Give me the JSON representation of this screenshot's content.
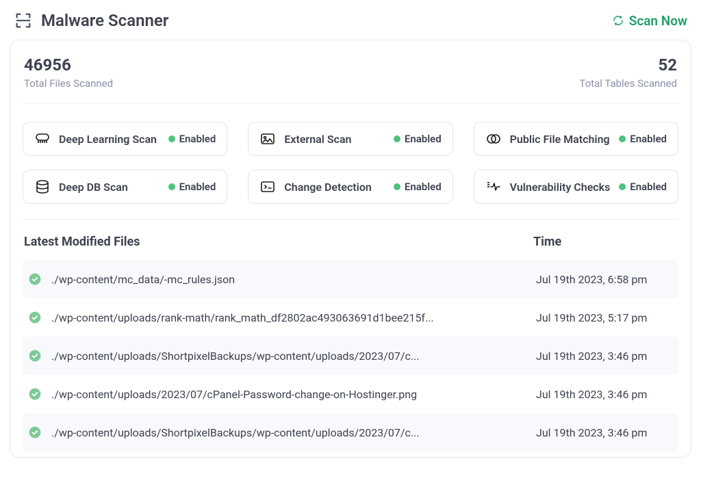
{
  "header": {
    "title": "Malware Scanner",
    "scan_now_label": "Scan Now"
  },
  "stats": {
    "files_scanned_value": "46956",
    "files_scanned_label": "Total Files Scanned",
    "tables_scanned_value": "52",
    "tables_scanned_label": "Total Tables Scanned"
  },
  "features": [
    {
      "name": "Deep Learning Scan",
      "status": "Enabled",
      "iconKey": "deep-learning"
    },
    {
      "name": "External Scan",
      "status": "Enabled",
      "iconKey": "external"
    },
    {
      "name": "Public File Matching",
      "status": "Enabled",
      "iconKey": "public-file"
    },
    {
      "name": "Deep DB Scan",
      "status": "Enabled",
      "iconKey": "db"
    },
    {
      "name": "Change Detection",
      "status": "Enabled",
      "iconKey": "change"
    },
    {
      "name": "Vulnerability Checks",
      "status": "Enabled",
      "iconKey": "vuln"
    }
  ],
  "files_table": {
    "header_file": "Latest Modified Files",
    "header_time": "Time",
    "rows": [
      {
        "path": "./wp-content/mc_data/-mc_rules.json",
        "time": "Jul 19th 2023, 6:58 pm"
      },
      {
        "path": "./wp-content/uploads/rank-math/rank_math_df2802ac493063691d1bee215f...",
        "time": "Jul 19th 2023, 5:17 pm"
      },
      {
        "path": "./wp-content/uploads/ShortpixelBackups/wp-content/uploads/2023/07/c...",
        "time": "Jul 19th 2023, 3:46 pm"
      },
      {
        "path": "./wp-content/uploads/2023/07/cPanel-Password-change-on-Hostinger.png",
        "time": "Jul 19th 2023, 3:46 pm"
      },
      {
        "path": "./wp-content/uploads/ShortpixelBackups/wp-content/uploads/2023/07/c...",
        "time": "Jul 19th 2023, 3:46 pm"
      }
    ]
  },
  "colors": {
    "accent_green": "#1f9e6a",
    "status_green": "#4cc281"
  }
}
